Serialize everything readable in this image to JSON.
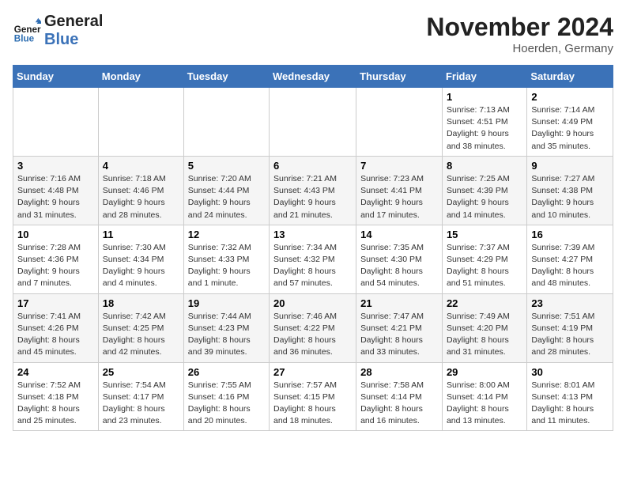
{
  "header": {
    "logo_line1": "General",
    "logo_line2": "Blue",
    "month_title": "November 2024",
    "location": "Hoerden, Germany"
  },
  "weekdays": [
    "Sunday",
    "Monday",
    "Tuesday",
    "Wednesday",
    "Thursday",
    "Friday",
    "Saturday"
  ],
  "weeks": [
    [
      {
        "day": "",
        "info": ""
      },
      {
        "day": "",
        "info": ""
      },
      {
        "day": "",
        "info": ""
      },
      {
        "day": "",
        "info": ""
      },
      {
        "day": "",
        "info": ""
      },
      {
        "day": "1",
        "info": "Sunrise: 7:13 AM\nSunset: 4:51 PM\nDaylight: 9 hours\nand 38 minutes."
      },
      {
        "day": "2",
        "info": "Sunrise: 7:14 AM\nSunset: 4:49 PM\nDaylight: 9 hours\nand 35 minutes."
      }
    ],
    [
      {
        "day": "3",
        "info": "Sunrise: 7:16 AM\nSunset: 4:48 PM\nDaylight: 9 hours\nand 31 minutes."
      },
      {
        "day": "4",
        "info": "Sunrise: 7:18 AM\nSunset: 4:46 PM\nDaylight: 9 hours\nand 28 minutes."
      },
      {
        "day": "5",
        "info": "Sunrise: 7:20 AM\nSunset: 4:44 PM\nDaylight: 9 hours\nand 24 minutes."
      },
      {
        "day": "6",
        "info": "Sunrise: 7:21 AM\nSunset: 4:43 PM\nDaylight: 9 hours\nand 21 minutes."
      },
      {
        "day": "7",
        "info": "Sunrise: 7:23 AM\nSunset: 4:41 PM\nDaylight: 9 hours\nand 17 minutes."
      },
      {
        "day": "8",
        "info": "Sunrise: 7:25 AM\nSunset: 4:39 PM\nDaylight: 9 hours\nand 14 minutes."
      },
      {
        "day": "9",
        "info": "Sunrise: 7:27 AM\nSunset: 4:38 PM\nDaylight: 9 hours\nand 10 minutes."
      }
    ],
    [
      {
        "day": "10",
        "info": "Sunrise: 7:28 AM\nSunset: 4:36 PM\nDaylight: 9 hours\nand 7 minutes."
      },
      {
        "day": "11",
        "info": "Sunrise: 7:30 AM\nSunset: 4:34 PM\nDaylight: 9 hours\nand 4 minutes."
      },
      {
        "day": "12",
        "info": "Sunrise: 7:32 AM\nSunset: 4:33 PM\nDaylight: 9 hours\nand 1 minute."
      },
      {
        "day": "13",
        "info": "Sunrise: 7:34 AM\nSunset: 4:32 PM\nDaylight: 8 hours\nand 57 minutes."
      },
      {
        "day": "14",
        "info": "Sunrise: 7:35 AM\nSunset: 4:30 PM\nDaylight: 8 hours\nand 54 minutes."
      },
      {
        "day": "15",
        "info": "Sunrise: 7:37 AM\nSunset: 4:29 PM\nDaylight: 8 hours\nand 51 minutes."
      },
      {
        "day": "16",
        "info": "Sunrise: 7:39 AM\nSunset: 4:27 PM\nDaylight: 8 hours\nand 48 minutes."
      }
    ],
    [
      {
        "day": "17",
        "info": "Sunrise: 7:41 AM\nSunset: 4:26 PM\nDaylight: 8 hours\nand 45 minutes."
      },
      {
        "day": "18",
        "info": "Sunrise: 7:42 AM\nSunset: 4:25 PM\nDaylight: 8 hours\nand 42 minutes."
      },
      {
        "day": "19",
        "info": "Sunrise: 7:44 AM\nSunset: 4:23 PM\nDaylight: 8 hours\nand 39 minutes."
      },
      {
        "day": "20",
        "info": "Sunrise: 7:46 AM\nSunset: 4:22 PM\nDaylight: 8 hours\nand 36 minutes."
      },
      {
        "day": "21",
        "info": "Sunrise: 7:47 AM\nSunset: 4:21 PM\nDaylight: 8 hours\nand 33 minutes."
      },
      {
        "day": "22",
        "info": "Sunrise: 7:49 AM\nSunset: 4:20 PM\nDaylight: 8 hours\nand 31 minutes."
      },
      {
        "day": "23",
        "info": "Sunrise: 7:51 AM\nSunset: 4:19 PM\nDaylight: 8 hours\nand 28 minutes."
      }
    ],
    [
      {
        "day": "24",
        "info": "Sunrise: 7:52 AM\nSunset: 4:18 PM\nDaylight: 8 hours\nand 25 minutes."
      },
      {
        "day": "25",
        "info": "Sunrise: 7:54 AM\nSunset: 4:17 PM\nDaylight: 8 hours\nand 23 minutes."
      },
      {
        "day": "26",
        "info": "Sunrise: 7:55 AM\nSunset: 4:16 PM\nDaylight: 8 hours\nand 20 minutes."
      },
      {
        "day": "27",
        "info": "Sunrise: 7:57 AM\nSunset: 4:15 PM\nDaylight: 8 hours\nand 18 minutes."
      },
      {
        "day": "28",
        "info": "Sunrise: 7:58 AM\nSunset: 4:14 PM\nDaylight: 8 hours\nand 16 minutes."
      },
      {
        "day": "29",
        "info": "Sunrise: 8:00 AM\nSunset: 4:14 PM\nDaylight: 8 hours\nand 13 minutes."
      },
      {
        "day": "30",
        "info": "Sunrise: 8:01 AM\nSunset: 4:13 PM\nDaylight: 8 hours\nand 11 minutes."
      }
    ]
  ]
}
